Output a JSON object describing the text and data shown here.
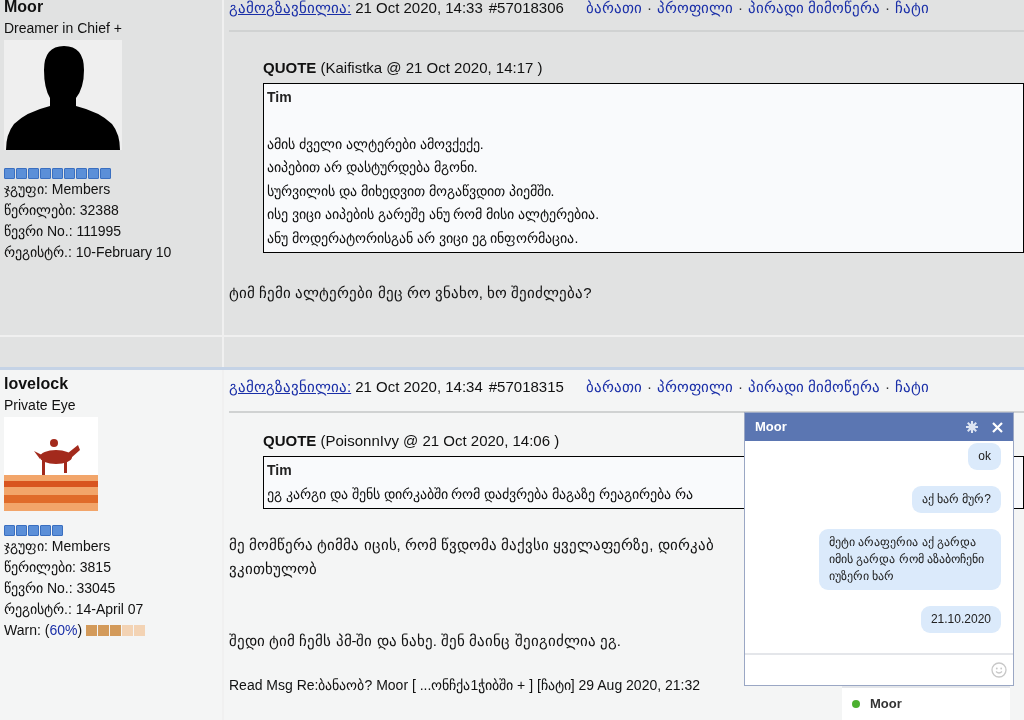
{
  "posts": [
    {
      "author": "Moor",
      "rank": "Dreamer in Chief +",
      "avatar": {
        "kind": "silhouette"
      },
      "rank_pips": {
        "stars": 9
      },
      "stats": [
        {
          "label": "ჯგუფი:",
          "value": "Members"
        },
        {
          "label": "წერილები:",
          "value": "32388"
        },
        {
          "label": "წევრი No.:",
          "value": "111995"
        },
        {
          "label": "რეგისტრ.:",
          "value": "10-February 10"
        }
      ],
      "posted_link": "გამოგზავნილია:",
      "date": "21 Oct 2020, 14:33",
      "number": "#57018306",
      "actions": [
        {
          "label": "ბარათი"
        },
        {
          "separator": "·",
          "label": "პროფილი"
        },
        {
          "separator": "·",
          "label": "პირადი მიმოწერა"
        },
        {
          "separator": "·",
          "label": "ჩატი"
        }
      ],
      "quote": {
        "header": "QUOTE",
        "meta": "(Kaifistka @ 21 Oct 2020, 14:17 )",
        "name": "Tim",
        "lines": [
          "ამის ძველი ალტერები ამოვქექე.",
          "აიპებით არ დასტურდება მგონი.",
          "სურვილის და მიხედვით მოგაწვდით პიემში.",
          "ისე ვიცი აიპების გარეშე ანუ რომ მისი ალტერებია.",
          "ანუ მოდერატორისგან არ ვიცი ეგ ინფორმაცია."
        ]
      },
      "body": [
        [
          "ტიმ ჩემი ალტერები მეც რო ვნახო, ხო შეიძლება?"
        ]
      ]
    },
    {
      "author": "lovelock",
      "rank": "Private Eye",
      "avatar": {
        "kind": "picture"
      },
      "rank_pips": {
        "stars": 5
      },
      "stats": [
        {
          "label": "ჯგუფი:",
          "value": "Members"
        },
        {
          "label": "წერილები:",
          "value": "3815"
        },
        {
          "label": "წევრი No.:",
          "value": "33045"
        },
        {
          "label": "რეგისტრ.:",
          "value": "14-April 07"
        }
      ],
      "warn": {
        "label": "Warn:",
        "open": "(",
        "percent": "60%",
        "close": ")",
        "stars": 3
      },
      "posted_link": "გამოგზავნილია:",
      "date": "21 Oct 2020, 14:34",
      "number": "#57018315",
      "actions": [
        {
          "label": "ბარათი"
        },
        {
          "separator": "·",
          "label": "პროფილი"
        },
        {
          "separator": "·",
          "label": "პირადი მიმოწერა"
        },
        {
          "separator": "·",
          "label": "ჩატი"
        }
      ],
      "quote": {
        "header": "QUOTE",
        "meta": "(PoisonnIvy @ 21 Oct 2020, 14:06 )",
        "name": "Tim",
        "lines": [
          "ეგ კარგი და შენს დირკაბში რომ დაძვრება მაგაზე რეაგირება რა"
        ]
      },
      "body": [
        [
          "მე მომწერა ტიმმა იცის, რომ წვდომა მაქვსი ყველაფერზე, დირკაბ",
          "ვკითხულობ"
        ],
        [
          "შედი ტიმ ჩემს პმ-ში და ნახე. შენ მაინც შეიგიძლია ეგ."
        ]
      ],
      "footer": "Read Msg Re:ბანაობ? Moor [ ...ონჩქა1ჭიბში + ] [ჩატი] 29 Aug 2020, 21:32"
    }
  ],
  "chat": {
    "title": "Moor",
    "messages": [
      "ok",
      "აქ ხარ მურ?",
      "მეტი არაფერია აქ გარდა იმის გარდა რომ აზაბოჩენი იუზერი ხარ",
      "21.10.2020"
    ],
    "contact": {
      "name": "Moor",
      "online": true
    }
  }
}
